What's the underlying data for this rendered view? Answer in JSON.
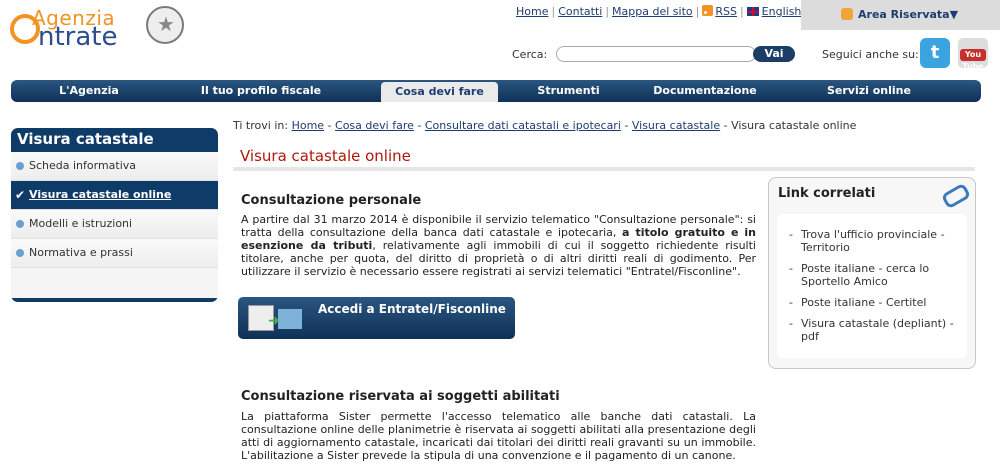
{
  "header": {
    "logo_line1": "Agenzia",
    "logo_line2": "ntrate",
    "top_links": [
      "Home",
      "Contatti",
      "Mappa del sito",
      "RSS",
      "English"
    ],
    "area_riservata": "Area Riservata▼",
    "search": {
      "label": "Cerca:",
      "placeholder": "",
      "value": "",
      "button": "Vai"
    },
    "social_label": "Seguici anche su:",
    "youtube_label": "You Tube"
  },
  "nav": {
    "items": [
      "L'Agenzia",
      "Il tuo profilo fiscale",
      "Cosa devi fare",
      "Strumenti",
      "Documentazione",
      "Servizi online"
    ],
    "active": "Cosa devi fare"
  },
  "sidebar": {
    "title": "Visura catastale",
    "items": [
      "Scheda informativa",
      "Visura catastale online",
      "Modelli e istruzioni",
      "Normativa e prassi"
    ],
    "active": "Visura catastale online"
  },
  "breadcrumb": {
    "prefix": "Ti trovi in:",
    "links": [
      "Home",
      "Cosa devi fare",
      "Consultare dati catastali e ipotecari",
      "Visura catastale"
    ],
    "current": "Visura catastale online"
  },
  "main": {
    "title": "Visura catastale online",
    "section1": {
      "heading": "Consultazione personale",
      "text_a": "A partire dal 31 marzo 2014 è disponibile il servizio telematico \"Consultazione personale\": si tratta della consultazione della banca dati catastale e ipotecaria, ",
      "text_bold": "a titolo gratuito e in esenzione da tributi",
      "text_b": ", relativamente agli immobili di cui il soggetto richiedente risulti titolare, anche per quota, del diritto di proprietà o di altri diritti reali di godimento. Per utilizzare il servizio è necessario essere registrati ai servizi telematici \"Entratel/Fisconline\"."
    },
    "accedi_button": "Accedi a Entratel/Fisconline",
    "section2": {
      "heading": "Consultazione riservata ai soggetti abilitati",
      "text": "La piattaforma Sister permette l'accesso telematico alle banche dati catastali. La consultazione online delle planimetrie è riservata ai soggetti abilitati alla presentazione degli atti di aggiornamento catastale, incaricati dai titolari dei diritti reali gravanti su un immobile. L'abilitazione a Sister prevede la stipula di una convenzione e il pagamento di un canone."
    }
  },
  "link_correlati": {
    "title": "Link correlati",
    "items": [
      "Trova l'ufficio provinciale - Territorio",
      "Poste italiane - cerca lo Sportello Amico",
      "Poste italiane - Certitel",
      "Visura catastale (depliant) - pdf"
    ]
  },
  "colors": {
    "navy": "#0f3b68",
    "orange": "#f39321",
    "title_red": "#b0170b"
  }
}
